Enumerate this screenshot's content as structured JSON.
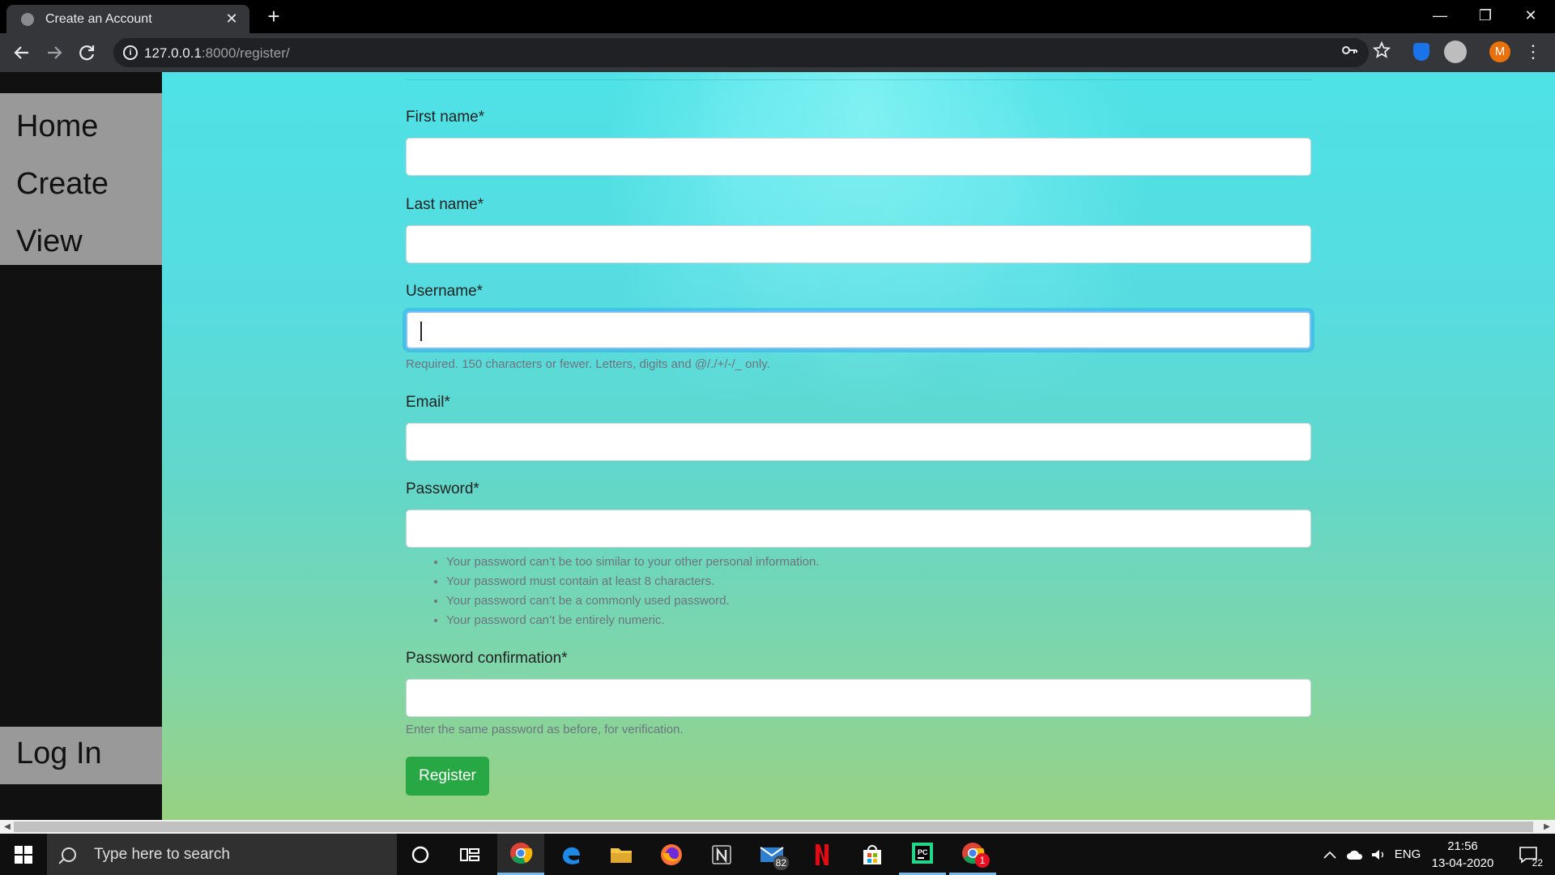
{
  "browser": {
    "tab_title": "Create an Account",
    "tab_close": "✕",
    "new_tab": "+",
    "window_controls": {
      "minimize": "—",
      "restore": "❐",
      "close": "✕"
    },
    "url_host": "127.0.0.1",
    "url_path": ":8000/register/",
    "profile_initial": "M",
    "icons": [
      "back-icon",
      "forward-icon",
      "reload-icon",
      "info-icon",
      "key-icon",
      "star-icon",
      "shield-extension-icon",
      "extension-icon",
      "menu-icon"
    ]
  },
  "sidebar": {
    "top_items": [
      {
        "label": "Home"
      },
      {
        "label": "Create"
      },
      {
        "label": "View"
      }
    ],
    "bottom_item": {
      "label": "Log In"
    }
  },
  "form": {
    "first_name": {
      "label": "First name*",
      "value": ""
    },
    "last_name": {
      "label": "Last name*",
      "value": ""
    },
    "username": {
      "label": "Username*",
      "value": "",
      "help": "Required. 150 characters or fewer. Letters, digits and @/./+/-/_ only."
    },
    "email": {
      "label": "Email*",
      "value": ""
    },
    "password": {
      "label": "Password*",
      "value": "",
      "help": [
        "Your password can’t be too similar to your other personal information.",
        "Your password must contain at least 8 characters.",
        "Your password can’t be a commonly used password.",
        "Your password can’t be entirely numeric."
      ]
    },
    "password_confirmation": {
      "label": "Password confirmation*",
      "value": "",
      "help": "Enter the same password as before, for verification."
    },
    "submit_label": "Register"
  },
  "taskbar": {
    "search_placeholder": "Type here to search",
    "mail_badge": "82",
    "chrome2_badge": "1",
    "language": "ENG",
    "time": "21:56",
    "date": "13-04-2020",
    "notifications": "22",
    "app_colors": {
      "accent": "#76b9ed",
      "netflix": "#e50914"
    }
  },
  "colors": {
    "sidebar_bg": "#111111",
    "sidebar_nav_bg": "#999999",
    "button_green": "#28a745",
    "focus_ring": "#80bdff"
  }
}
